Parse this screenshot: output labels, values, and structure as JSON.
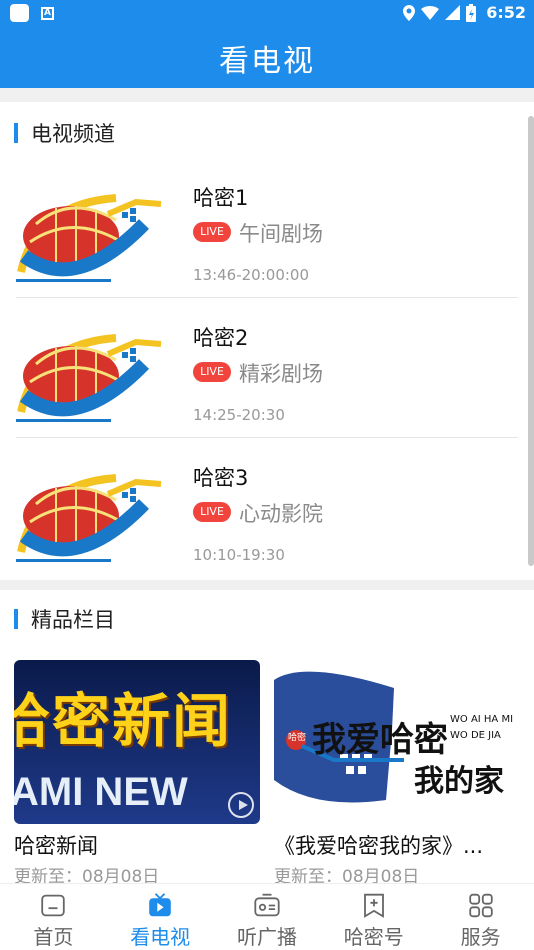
{
  "status_bar": {
    "time": "6:52"
  },
  "title": "看电视",
  "channels_section": {
    "title": "电视频道",
    "channels": [
      {
        "name": "哈密1",
        "badge": "LIVE",
        "program": "午间剧场",
        "time": "13:46-20:00:00"
      },
      {
        "name": "哈密2",
        "badge": "LIVE",
        "program": "精彩剧场",
        "time": "14:25-20:30"
      },
      {
        "name": "哈密3",
        "badge": "LIVE",
        "program": "心动影院",
        "time": "10:10-19:30"
      }
    ]
  },
  "featured_section": {
    "title": "精品栏目",
    "cards": [
      {
        "thumb_top": "哈密新闻",
        "thumb_bottom": "AMI NEW",
        "title": "哈密新闻",
        "updated": "更新至：08月08日"
      },
      {
        "thumb_main": "我爱哈密",
        "thumb_sub": "我的家",
        "thumb_en1": "WO AI HA MI",
        "thumb_en2": "WO DE JIA",
        "thumb_seal": "哈密",
        "title": "《我爱哈密我的家》...",
        "updated": "更新至：08月08日"
      }
    ]
  },
  "bottom_nav": [
    {
      "label": "首页",
      "icon": "home-icon",
      "active": false
    },
    {
      "label": "看电视",
      "icon": "tv-icon",
      "active": true
    },
    {
      "label": "听广播",
      "icon": "radio-icon",
      "active": false
    },
    {
      "label": "哈密号",
      "icon": "bookmark-plus-icon",
      "active": false
    },
    {
      "label": "服务",
      "icon": "grid-icon",
      "active": false
    }
  ],
  "colors": {
    "primary": "#1e8ceb",
    "live": "#f0443c"
  }
}
